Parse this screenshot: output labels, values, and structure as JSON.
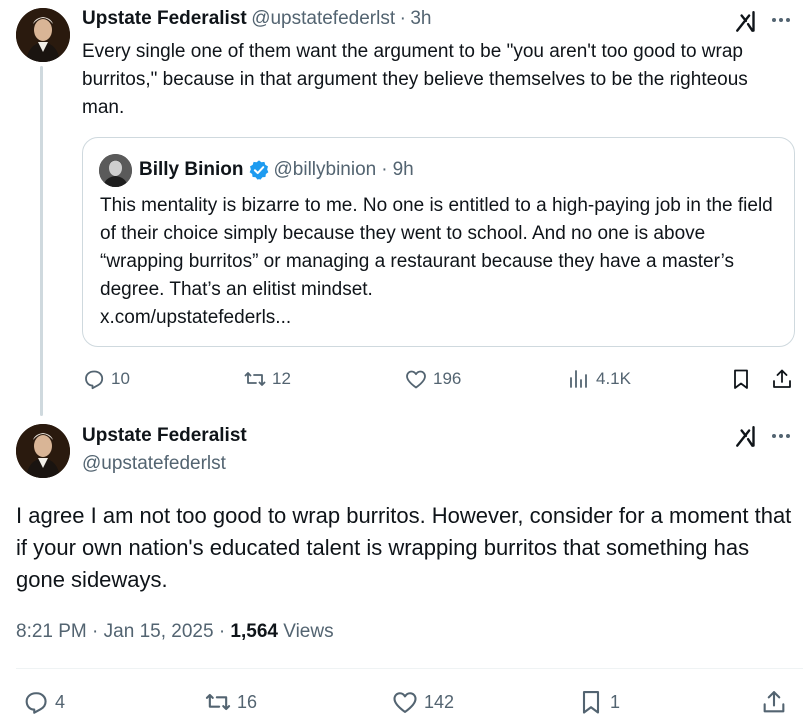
{
  "tweet1": {
    "name": "Upstate Federalist",
    "handle": "@upstatefederlst",
    "separator": "·",
    "time": "3h",
    "text": "Every single one of them want the argument to be \"you aren't too good to wrap burritos,\" because in that argument they believe themselves to be the righteous man.",
    "quote": {
      "name": "Billy Binion",
      "handle": "@billybinion",
      "separator": "·",
      "time": "9h",
      "text": "This mentality is bizarre to me. No one is entitled to a high-paying job in the field of their choice simply because they went to school. And no one is above “wrapping burritos” or managing a restaurant because they have a master’s degree. That’s an elitist mindset.",
      "link": "x.com/upstatefederls..."
    },
    "actions": {
      "replies": "10",
      "reposts": "12",
      "likes": "196",
      "views": "4.1K"
    }
  },
  "tweet2": {
    "name": "Upstate Federalist",
    "handle": "@upstatefederlst",
    "text": "I agree I am not too good to wrap burritos. However, consider for a moment that if your own nation's educated talent is wrapping burritos that something has gone sideways.",
    "time": "8:21 PM",
    "date": "Jan 15, 2025",
    "separator": "·",
    "views_count": "1,564",
    "views_label": "Views",
    "actions": {
      "replies": "4",
      "reposts": "16",
      "likes": "142",
      "bookmarks": "1"
    }
  },
  "icons": {
    "reply": "reply-icon",
    "repost": "repost-icon",
    "like": "heart-icon",
    "views": "analytics-icon",
    "bookmark": "bookmark-icon",
    "share": "share-icon",
    "grok": "grok-icon",
    "more": "more-icon",
    "verified": "verified-badge-icon"
  },
  "colors": {
    "text": "#0f1419",
    "secondary": "#536471",
    "border": "#cfd9de",
    "verified": "#1d9bf0"
  }
}
